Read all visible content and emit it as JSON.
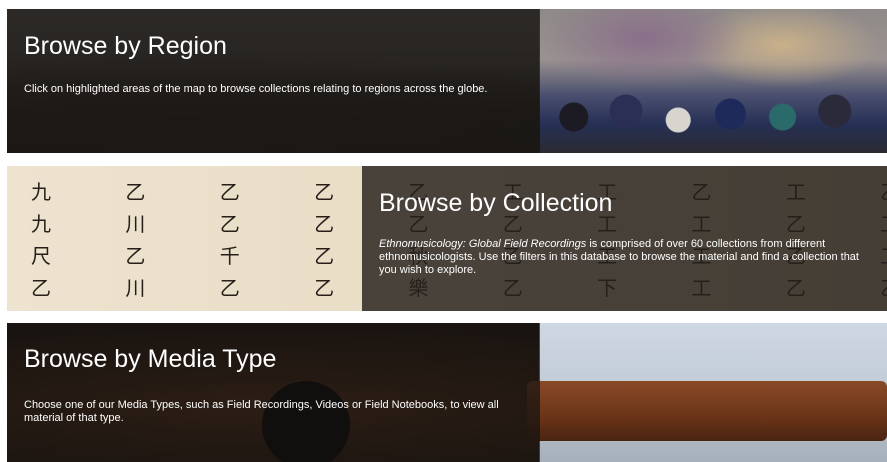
{
  "panels": {
    "region": {
      "title": "Browse by Region",
      "description": "Click on highlighted areas of the map to browse collections relating to regions across the globe."
    },
    "collection": {
      "title": "Browse by Collection",
      "description_italic": "Ethnomusicology: Global Field Recordings",
      "description_rest": " is comprised of over 60 collections from different ethnomusicologists. Use the filters in this database to browse the material and find a collection that you wish to explore."
    },
    "media": {
      "title": "Browse by Media Type",
      "description": "Choose one of our Media Types, such as Field Recordings, Videos or Field Notebooks, to view all material of that type."
    }
  }
}
